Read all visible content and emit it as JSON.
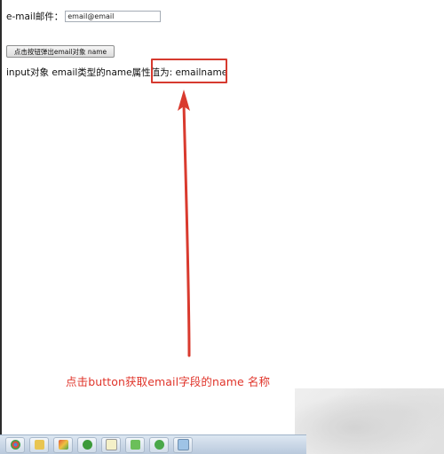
{
  "email_label": "e-mail邮件：",
  "email_input_value": "email@email",
  "button_label": "点击按钮弹出email对象 name",
  "result_prefix": "input对象 email类型的name属性值为: ",
  "result_value": "emailname",
  "annotation_text": "点击button获取email字段的name 名称",
  "colors": {
    "annotation": "#e0342a",
    "highlight": "#d63a2f"
  },
  "taskbar_icons": [
    "chrome-icon",
    "folder-icon",
    "paint-icon",
    "green-circle-icon",
    "notepad-icon",
    "network-icon",
    "refresh-icon",
    "document-icon"
  ]
}
